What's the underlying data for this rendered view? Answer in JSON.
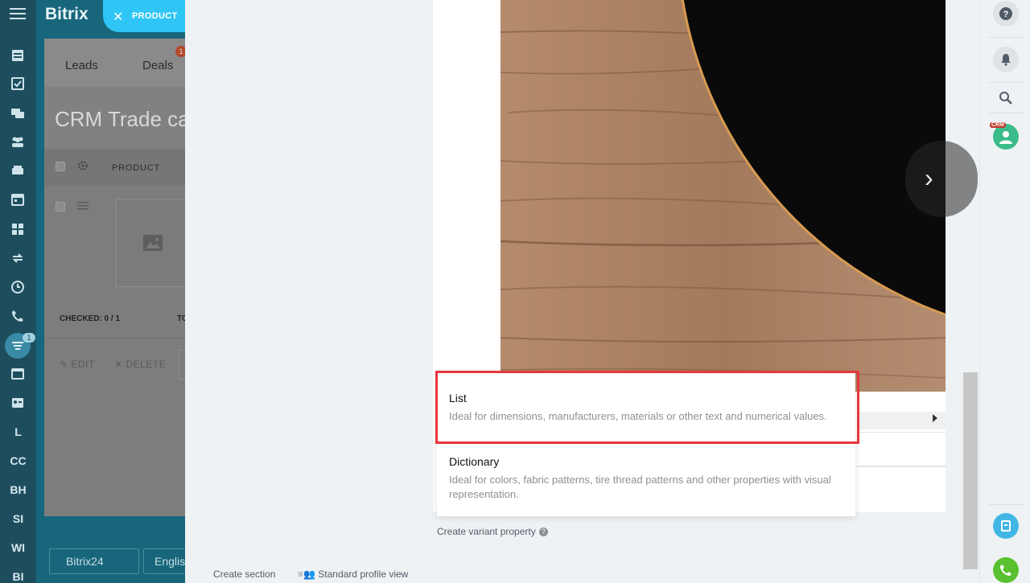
{
  "brand": "Bitrix",
  "close_pill": {
    "label": "PRODUCT"
  },
  "crm": {
    "tabs": [
      {
        "label": "Leads"
      },
      {
        "label": "Deals"
      }
    ],
    "deals_badge": "1",
    "title": "CRM Trade cat",
    "column_product": "PRODUCT",
    "checked": "CHECKED: 0 / 1",
    "to_label": "TO",
    "edit": "EDIT",
    "delete": "DELETE",
    "footer_btn_1": "Bitrix24",
    "footer_btn_2": "Englis"
  },
  "leftnav": {
    "filter_badge": "1",
    "text_items": [
      "L",
      "CC",
      "BH",
      "SI",
      "WI",
      "BI"
    ]
  },
  "popup": {
    "items": [
      {
        "title": "List",
        "description": "Ideal for dimensions, manufacturers, materials or other text and numerical values."
      },
      {
        "title": "Dictionary",
        "description": "Ideal for colors, fabric patterns, tire thread patterns and other properties with visual representation."
      }
    ]
  },
  "create_variant_property": "Create variant property",
  "footer": {
    "create_section": "Create section",
    "standard_profile_view": "Standard profile view"
  },
  "rightpanel": {
    "crm_tag": "CRM"
  },
  "colors": {
    "accent": "#2fc6f6",
    "highlight": "#e8383d",
    "nav": "#1e4e5e",
    "phone": "#3bc8a6"
  }
}
